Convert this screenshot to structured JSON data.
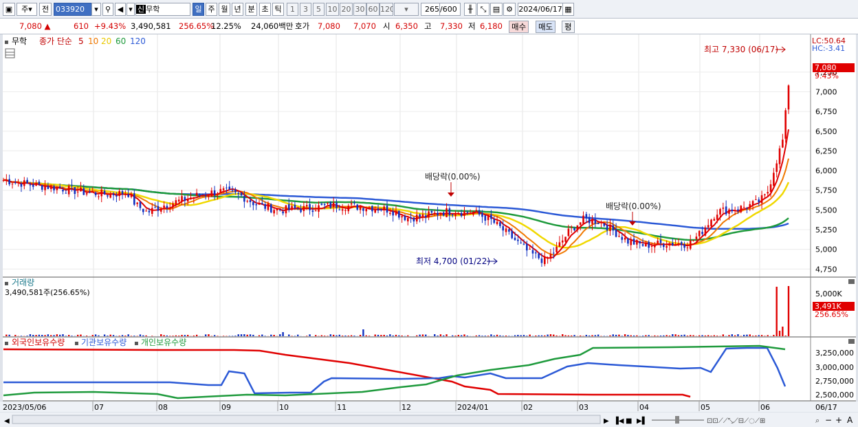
{
  "toolbar": {
    "type_label": "주",
    "prev_label": "전",
    "code": "033920",
    "name_badge": "신",
    "name": "무학",
    "period_day": "일",
    "period_week": "주",
    "period_month": "월",
    "period_year": "년",
    "period_min": "분",
    "period_sec": "초",
    "period_tick": "틱",
    "intervals": [
      "1",
      "3",
      "5",
      "10",
      "20",
      "30",
      "60",
      "120"
    ],
    "count": "265",
    "total": "/600",
    "date": "2024/06/17"
  },
  "quote": {
    "price": "7,080 ▲",
    "change": "610",
    "rate": "+9.43%",
    "volume": "3,490,581",
    "vol_rate": "256.65%",
    "turnover": "12.25%",
    "amount": "24,060백만",
    "bid_label": "호가",
    "bid1": "7,080",
    "bid2": "7,070",
    "open_label": "시",
    "open": "6,350",
    "high_label": "고",
    "high": "7,330",
    "low_label": "저",
    "low": "6,180",
    "buy": "매수",
    "sell": "매도",
    "eval": "평"
  },
  "price_panel": {
    "name": "무학",
    "ma_label": "종가 단순",
    "ma_periods": [
      "5",
      "10",
      "20",
      "60",
      "120"
    ],
    "lc": "LC:50.64",
    "hc": "HC:-3.41",
    "price_ticks": [
      "7,250",
      "7,000",
      "6,750",
      "6,500",
      "6,250",
      "6,000",
      "5,750",
      "5,500",
      "5,250",
      "5,000",
      "4,750"
    ],
    "last_price": "7,080",
    "last_rate": "9.43%",
    "annotations": {
      "high": "최고 7,330 (06/17)",
      "low": "최저 4,700 (01/22)",
      "div1": "배당락(0.00%)",
      "div2": "배당락(0.00%)"
    }
  },
  "volume_panel": {
    "title": "거래량",
    "value": "3,490,581주(256.65%)",
    "tick": "5,000K",
    "last": "3,491K",
    "last_rate": "256.65%"
  },
  "holdings_panel": {
    "foreign": "외국인보유수량",
    "inst": "기관보유수량",
    "indiv": "개인보유수량",
    "ticks": [
      "3,250,000",
      "3,000,000",
      "2,750,000",
      "2,500,000"
    ]
  },
  "dates": [
    "2023/05/06",
    "07",
    "08",
    "09",
    "10",
    "11",
    "12",
    "2024/01",
    "02",
    "03",
    "04",
    "05",
    "06",
    "06/17"
  ],
  "colors": {
    "ma5": "#e00000",
    "ma10": "#f07800",
    "ma20": "#f0d800",
    "ma60": "#1e9a3c",
    "ma120": "#2b59d6",
    "up": "#e00000",
    "down": "#1030c0"
  }
}
